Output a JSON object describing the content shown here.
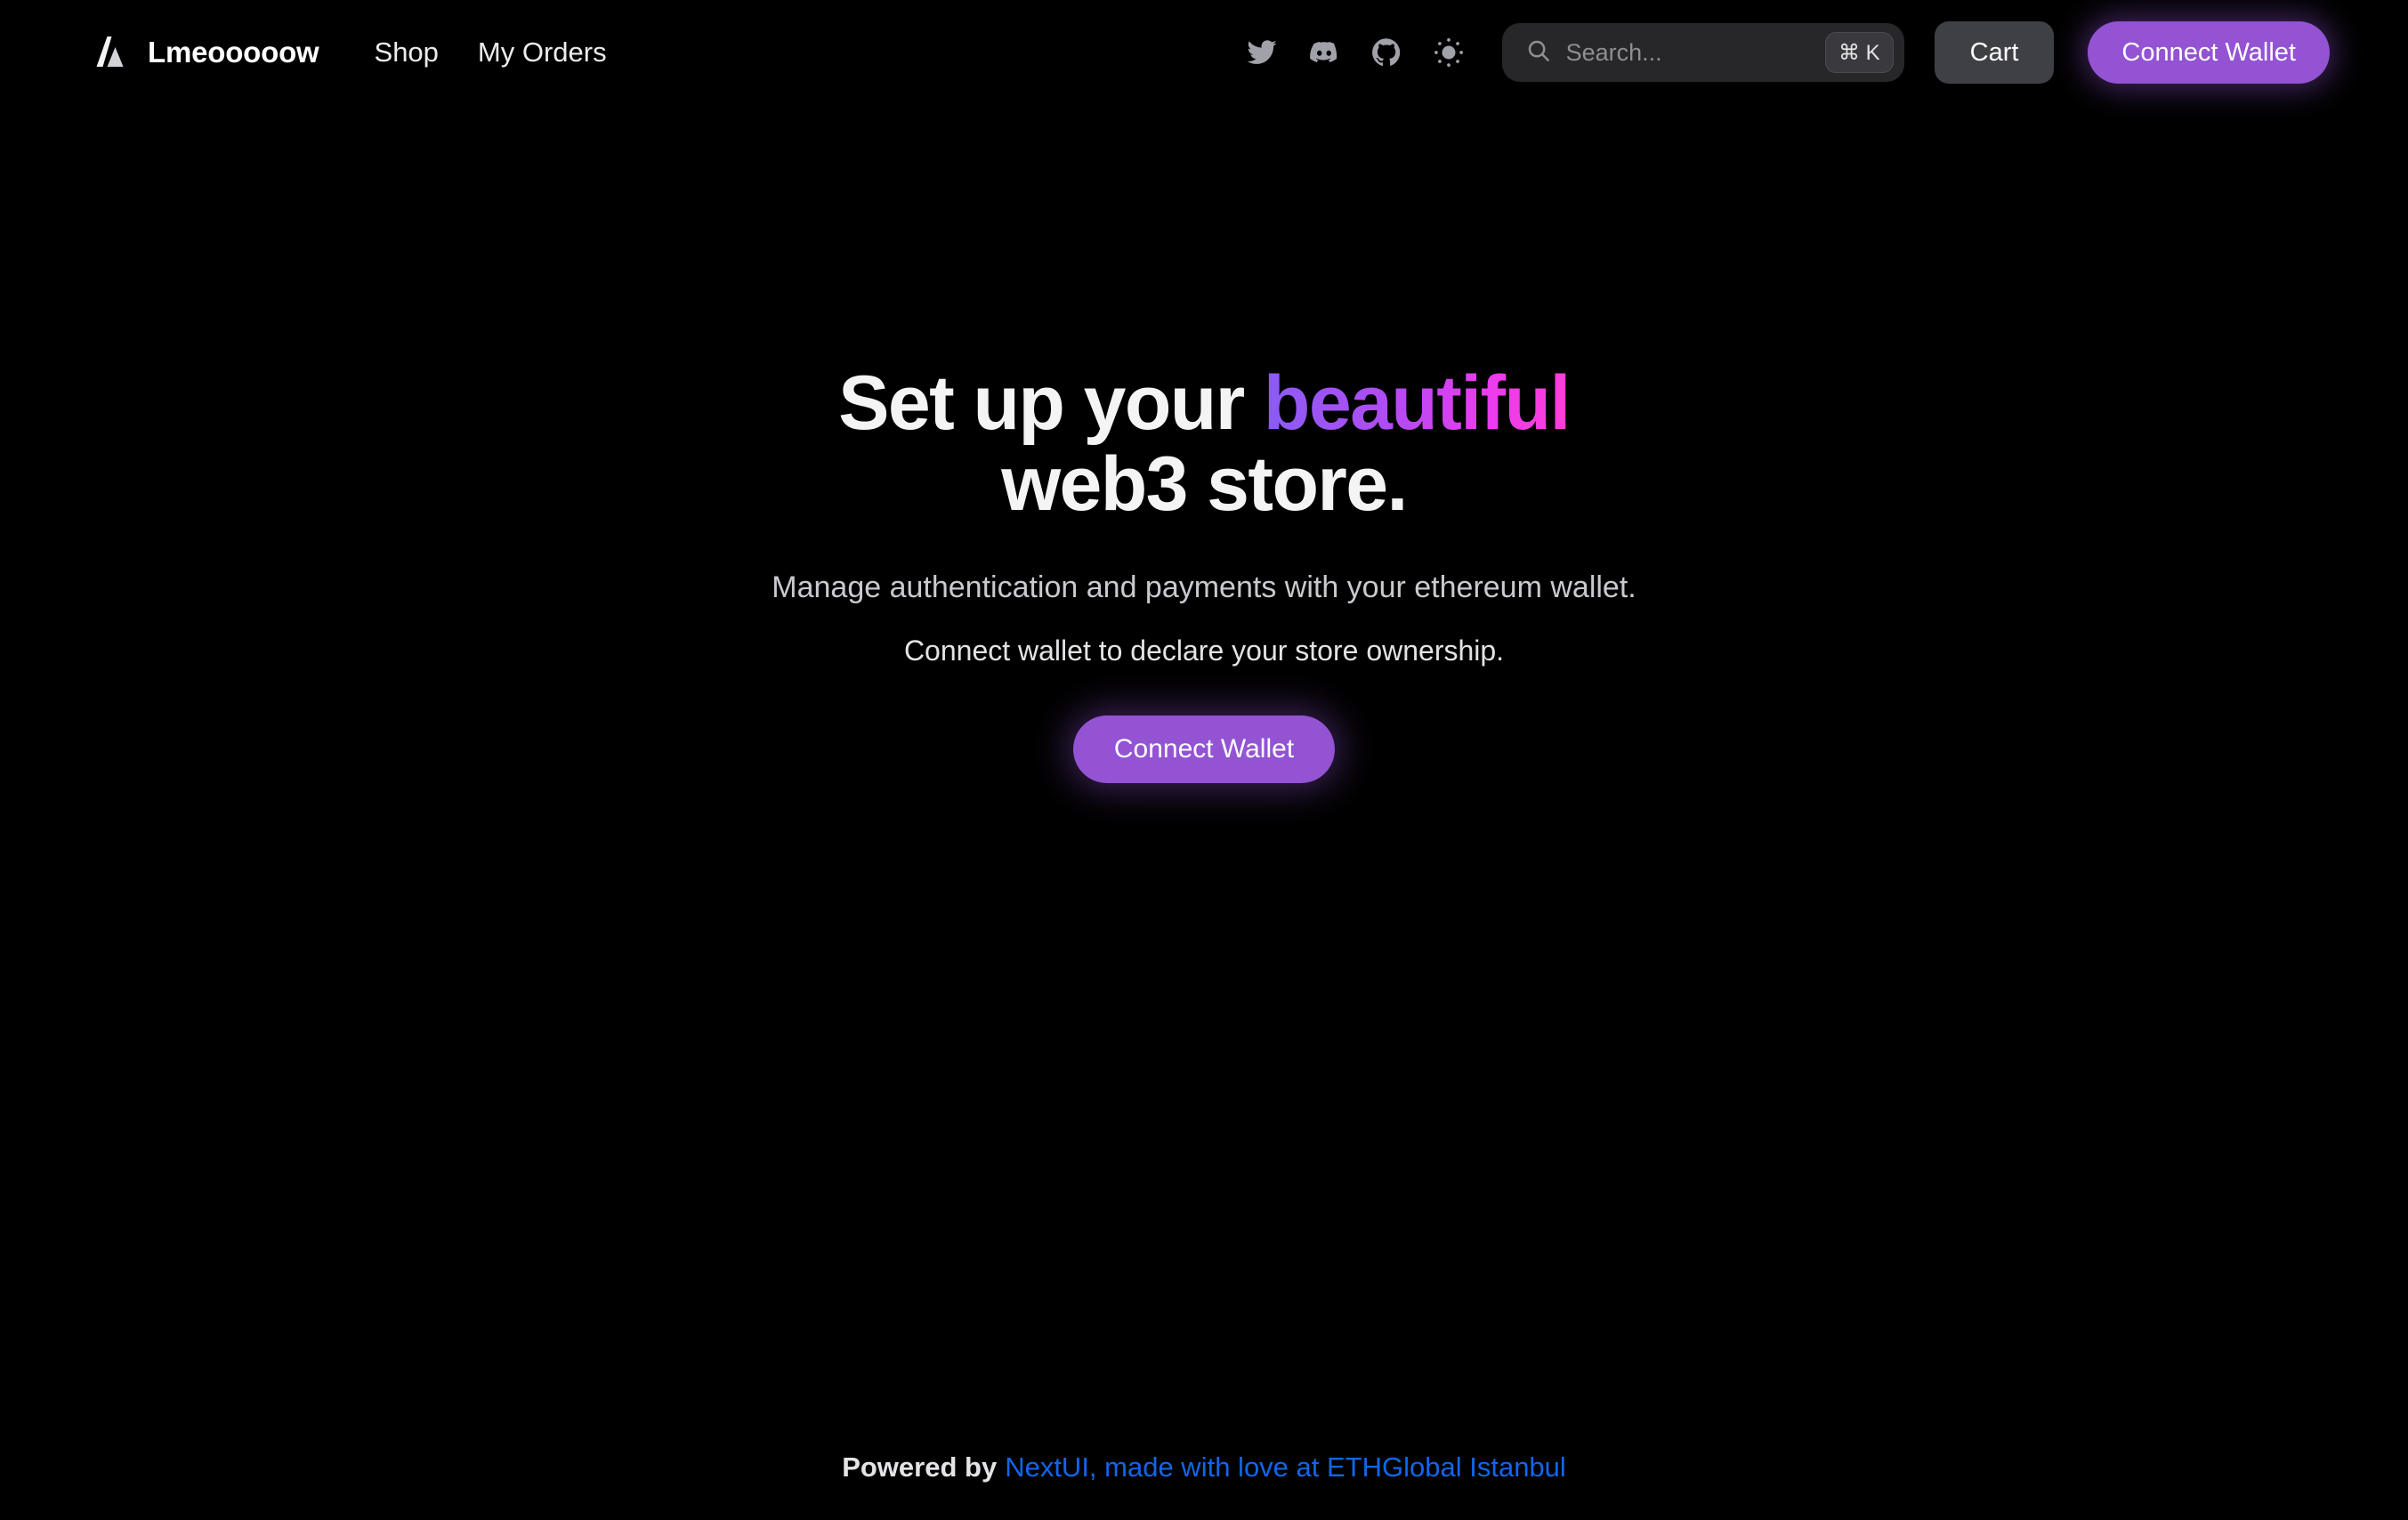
{
  "brand": {
    "logo_icon": "triangle-a-logo-icon",
    "name": "Lmeooooow"
  },
  "nav": {
    "links": [
      {
        "label": "Shop",
        "name": "shop"
      },
      {
        "label": "My Orders",
        "name": "my-orders"
      }
    ]
  },
  "social": {
    "items": [
      {
        "icon": "twitter-icon",
        "name": "twitter"
      },
      {
        "icon": "discord-icon",
        "name": "discord"
      },
      {
        "icon": "github-icon",
        "name": "github"
      },
      {
        "icon": "sun-icon",
        "name": "theme-toggle"
      }
    ]
  },
  "search": {
    "icon": "search-icon",
    "value": "",
    "placeholder": "Search...",
    "shortcut": "⌘ K"
  },
  "actions": {
    "cart_label": "Cart",
    "connect_wallet_label": "Connect Wallet"
  },
  "hero": {
    "headline_part1": "Set up your ",
    "headline_accent": "beautiful",
    "headline_part2": "web3 store.",
    "subtitle": "Manage authentication and payments with your ethereum wallet.",
    "subtitle_2": "Connect wallet to declare your store ownership.",
    "cta_label": "Connect Wallet"
  },
  "footer": {
    "prefix": "Powered by",
    "link_label": "NextUI, made with love at ETHGlobal Istanbul"
  },
  "colors": {
    "background": "#000000",
    "accent_purple": "#9353D3",
    "gradient_start": "#8A5CF6",
    "gradient_end": "#FF3DD8",
    "link_blue": "#1166E8",
    "surface": "#27272A",
    "cart_surface": "#3F3F46"
  }
}
